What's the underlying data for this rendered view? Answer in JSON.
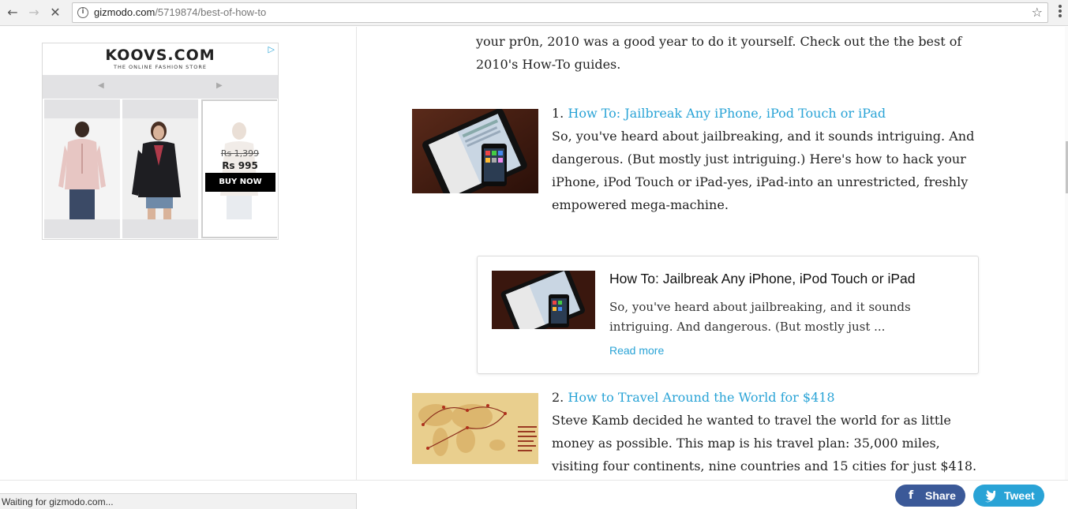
{
  "browser": {
    "back_icon": "←",
    "forward_icon": "→",
    "stop_icon": "✕",
    "info_icon": "i",
    "url_host": "gizmodo.com",
    "url_path": "/5719874/best-of-how-to",
    "bookmark_icon": "☆"
  },
  "ad": {
    "logo": "KOOVS.COM",
    "tagline": "THE ONLINE FASHION STORE",
    "adchoices_icon": "▷",
    "prev_icon": "◀",
    "next_icon": "▶",
    "old_price": "Rs 1,399",
    "new_price": "Rs 995",
    "cta": "BUY NOW"
  },
  "article": {
    "intro": "your pr0n, 2010 was a good year to do it yourself. Check out the the best of 2010's How-To guides.",
    "items": [
      {
        "number": "1.",
        "title": "How To: Jailbreak Any iPhone, iPod Touch or iPad",
        "body": "So, you've heard about jailbreaking, and it sounds intriguing. And dangerous. (But mostly just intriguing.) Here's how to hack your iPhone, iPod Touch or iPad-yes, iPad-into an unrestricted, freshly empowered mega-machine."
      },
      {
        "number": "2.",
        "title": "How to Travel Around the World for $418",
        "body": "Steve Kamb decided he wanted to travel the world for as little money as possible. This map is his travel plan: 35,000 miles, visiting four continents, nine countries and 15 cities for just $418."
      }
    ],
    "card": {
      "title": "How To: Jailbreak Any iPhone, iPod Touch or iPad",
      "excerpt": "So, you've heard about jailbreaking, and it sounds intriguing. And dangerous. (But mostly just ...",
      "read_more": "Read more"
    }
  },
  "status": "Waiting for gizmodo.com...",
  "social": {
    "share_icon": "f",
    "share_label": "Share",
    "share_color": "#3b5998",
    "tweet_icon": "🐦",
    "tweet_label": "Tweet",
    "tweet_color": "#29a3d6"
  },
  "colors": {
    "link": "#29a3d6"
  }
}
